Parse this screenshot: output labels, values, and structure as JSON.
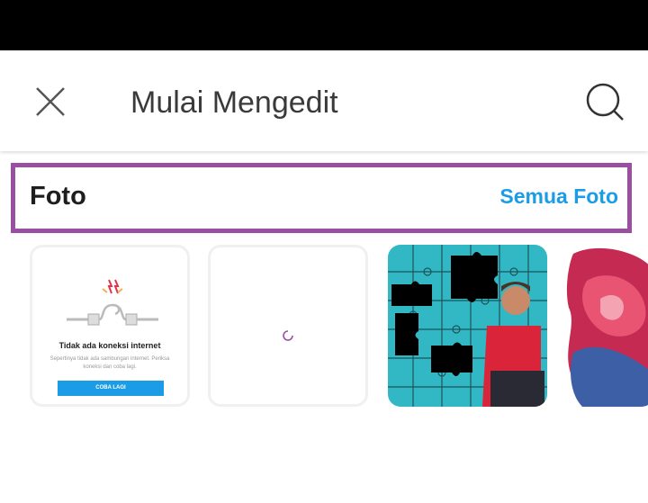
{
  "header": {
    "title": "Mulai Mengedit",
    "close_icon": "close-icon",
    "search_icon": "search-icon"
  },
  "photos_section": {
    "title": "Foto",
    "see_all_label": "Semua Foto",
    "accent_color": "#1b9ce6",
    "highlight_color": "#9b4fa3"
  },
  "cards": {
    "error": {
      "icon": "disconnected-cable-icon",
      "title": "Tidak ada koneksi internet",
      "message": "Sepertinya tidak ada sambungan internet. Periksa koneksi dan coba lagi.",
      "retry_label": "COBA LAGI"
    },
    "loading": {
      "icon": "loading-spinner-icon"
    },
    "items": [
      {
        "type": "photo",
        "subject": "puzzle-wall-man-photo"
      },
      {
        "type": "photo",
        "subject": "color-smoke-photo"
      }
    ]
  }
}
